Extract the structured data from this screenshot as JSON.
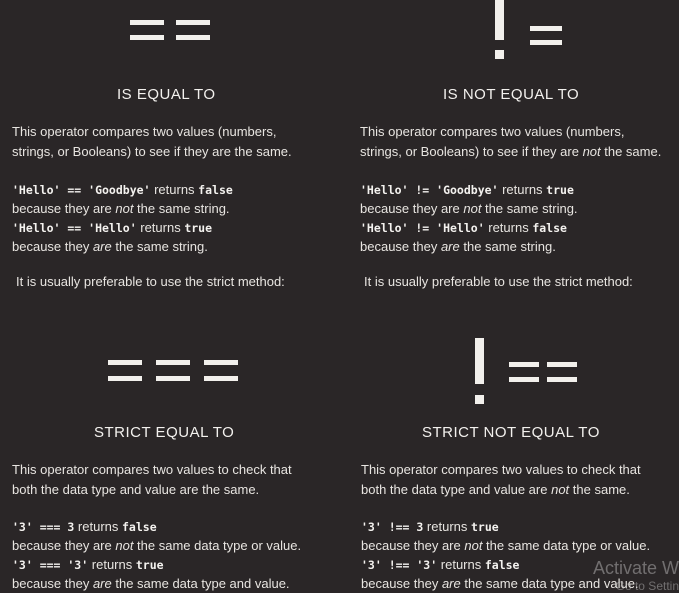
{
  "panels": {
    "equal": {
      "symbol": "==",
      "heading": "IS EQUAL TO",
      "desc_line1": "This operator compares two values (numbers,",
      "desc_line2": "strings, or Booleans) to see if they are the same.",
      "ex1_code": "'Hello' == 'Goodbye'",
      "ex1_text": " returns ",
      "ex1_result": "false",
      "ex1_reason_a": "because they are ",
      "ex1_reason_em": "not",
      "ex1_reason_b": " the same string.",
      "ex2_code": "'Hello' == 'Hello'",
      "ex2_text": " returns ",
      "ex2_result": "true",
      "ex2_reason_a": "because they ",
      "ex2_reason_em": "are",
      "ex2_reason_b": " the same string.",
      "note": "It is usually preferable to use the strict method:"
    },
    "not_equal": {
      "symbol": "!=",
      "heading": "IS NOT EQUAL TO",
      "desc_line1": "This operator compares two values (numbers,",
      "desc_line2a": "strings, or Booleans) to see if they are ",
      "desc_line2_em": "not",
      "desc_line2b": " the same.",
      "ex1_code": "'Hello' != 'Goodbye'",
      "ex1_text": " returns ",
      "ex1_result": "true",
      "ex1_reason_a": "because they are ",
      "ex1_reason_em": "not",
      "ex1_reason_b": " the same string.",
      "ex2_code": "'Hello' != 'Hello'",
      "ex2_text": " returns ",
      "ex2_result": "false",
      "ex2_reason_a": "because they ",
      "ex2_reason_em": "are",
      "ex2_reason_b": " the same string.",
      "note": "It is usually preferable to use the strict method:"
    },
    "strict_equal": {
      "symbol": "===",
      "heading": "STRICT EQUAL TO",
      "desc_line1": "This operator compares two values to check that",
      "desc_line2": "both the data type and value are the same.",
      "ex1_code": "'3' === 3",
      "ex1_text": " returns ",
      "ex1_result": "false",
      "ex1_reason_a": "because they are ",
      "ex1_reason_em": "not",
      "ex1_reason_b": " the same data type or value.",
      "ex2_code": "'3' === '3'",
      "ex2_text": " returns ",
      "ex2_result": "true",
      "ex2_reason_a": "because they ",
      "ex2_reason_em": "are",
      "ex2_reason_b": " the same data type and value."
    },
    "strict_not_equal": {
      "symbol": "!==",
      "heading": "STRICT NOT EQUAL TO",
      "desc_line1": "This operator compares two values to check that",
      "desc_line2a": "both the data type and value are ",
      "desc_line2_em": "not",
      "desc_line2b": " the same.",
      "ex1_code": "'3' !== 3",
      "ex1_text": " returns ",
      "ex1_result": "true",
      "ex1_reason_a": "because they are ",
      "ex1_reason_em": "not",
      "ex1_reason_b": " the same data type or value.",
      "ex2_code": "'3' !== '3'",
      "ex2_text": " returns ",
      "ex2_result": "false",
      "ex2_reason_a": "because they ",
      "ex2_reason_em": "are",
      "ex2_reason_b": " the same data type and value."
    }
  },
  "watermark": {
    "line1": "Activate W",
    "line2": "Go to Settin"
  }
}
